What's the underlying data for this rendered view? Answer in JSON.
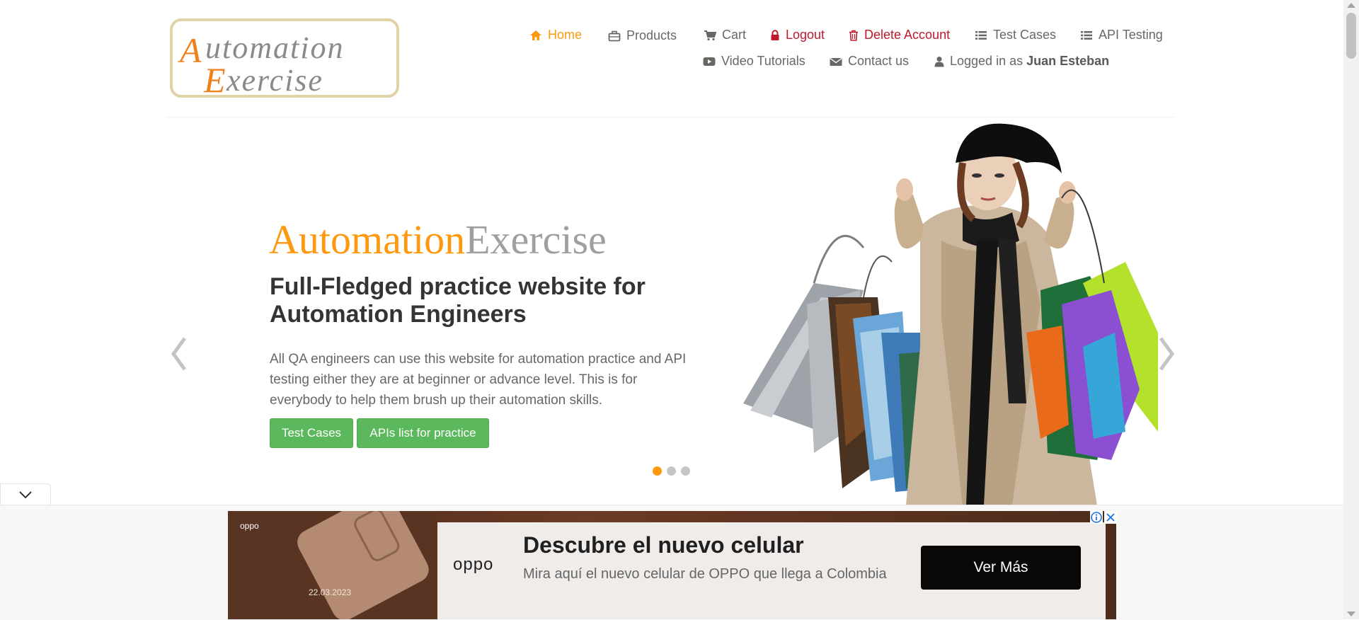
{
  "header": {
    "logo_text_line1": "Automation",
    "logo_text_line2": "Exercise",
    "nav": {
      "home": "Home",
      "products": "Products",
      "cart": "Cart",
      "logout": "Logout",
      "delete_account": "Delete Account",
      "test_cases": "Test Cases",
      "api_testing": "API Testing",
      "video_tutorials": "Video Tutorials",
      "contact_us": "Contact us",
      "logged_in_prefix": "Logged in as",
      "logged_in_user": "Juan Esteban"
    }
  },
  "slider": {
    "brand_part1": "Automation",
    "brand_part2": "Exercise",
    "title": "Full-Fledged practice website for Automation Engineers",
    "text": "All QA engineers can use this website for automation practice and API testing either they are at beginner or advance level. This is for everybody to help them brush up their automation skills.",
    "btn_test_cases": "Test Cases",
    "btn_apis": "APIs list for practice",
    "active_slide": 1,
    "slide_count": 3
  },
  "ad": {
    "small_brand": "oppo",
    "date": "22.03.2023",
    "brand": "oppo",
    "headline": "Descubre el nuevo celular",
    "subtext": "Mira aquí el nuevo celular de OPPO que llega a Colombia",
    "cta": "Ver Más"
  },
  "colors": {
    "accent": "#fe980f",
    "danger": "#c0192b",
    "button_green": "#5cb85c",
    "brand_gray": "#a09f9b"
  },
  "icons": [
    "home-icon",
    "briefcase-icon",
    "cart-icon",
    "lock-icon",
    "trash-icon",
    "list-icon",
    "youtube-icon",
    "envelope-icon",
    "user-icon",
    "chevron-left-icon",
    "chevron-right-icon",
    "chevron-down-icon",
    "ad-info-icon",
    "ad-close-icon"
  ]
}
